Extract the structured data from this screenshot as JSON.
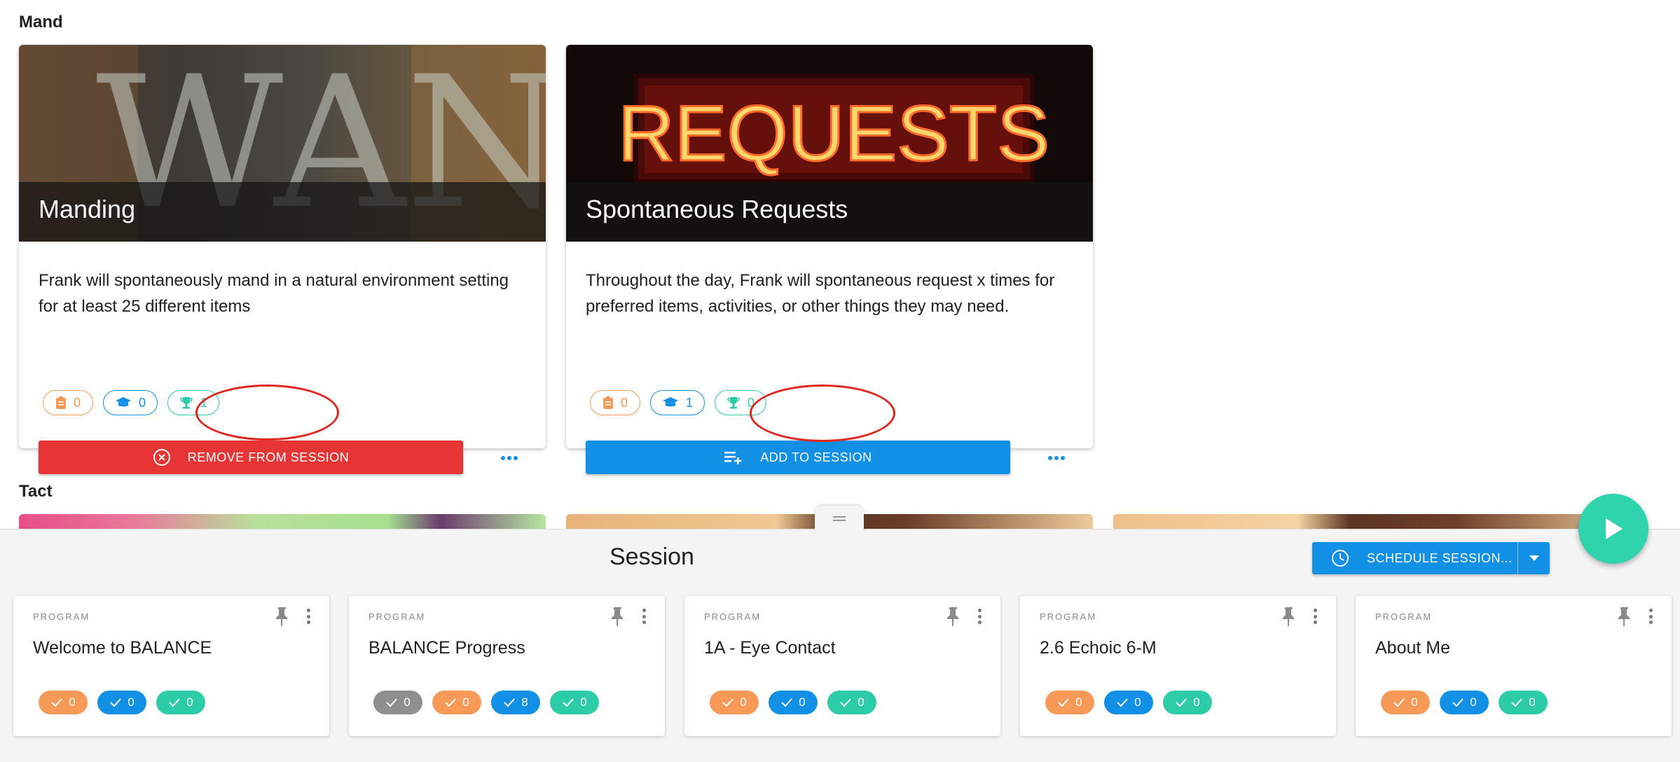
{
  "sections": {
    "mand_title": "Mand",
    "tact_title": "Tact"
  },
  "cards": [
    {
      "image_text": "WANT",
      "title": "Manding",
      "description": "Frank will spontaneously mand in a natural environment setting for at least 25 different items",
      "chips": {
        "clipboard": "0",
        "cap": "0",
        "trophy": "1"
      },
      "action_label": "REMOVE FROM SESSION",
      "action_color": "#e73535"
    },
    {
      "image_text": "REQUESTS",
      "title": "Spontaneous Requests",
      "description": "Throughout the day, Frank will spontaneous request x times for preferred items, activities, or other things they may need.",
      "chips": {
        "clipboard": "0",
        "cap": "1",
        "trophy": "0"
      },
      "action_label": "ADD TO SESSION",
      "action_color": "#1190e6"
    }
  ],
  "session": {
    "title": "Session",
    "schedule_label": "SCHEDULE SESSION...",
    "programs": [
      {
        "type": "PROGRAM",
        "name": "Welcome to BALANCE",
        "chips": [
          {
            "color": "orange",
            "value": "0"
          },
          {
            "color": "blue",
            "value": "0"
          },
          {
            "color": "green",
            "value": "0"
          }
        ]
      },
      {
        "type": "PROGRAM",
        "name": "BALANCE Progress",
        "chips": [
          {
            "color": "gray",
            "value": "0"
          },
          {
            "color": "orange",
            "value": "0"
          },
          {
            "color": "blue",
            "value": "8"
          },
          {
            "color": "green",
            "value": "0"
          }
        ]
      },
      {
        "type": "PROGRAM",
        "name": "1A - Eye Contact",
        "chips": [
          {
            "color": "orange",
            "value": "0"
          },
          {
            "color": "blue",
            "value": "0"
          },
          {
            "color": "green",
            "value": "0"
          }
        ]
      },
      {
        "type": "PROGRAM",
        "name": "2.6 Echoic 6-M",
        "chips": [
          {
            "color": "orange",
            "value": "0"
          },
          {
            "color": "blue",
            "value": "0"
          },
          {
            "color": "green",
            "value": "0"
          }
        ]
      },
      {
        "type": "PROGRAM",
        "name": "About Me",
        "chips": [
          {
            "color": "orange",
            "value": "0"
          },
          {
            "color": "blue",
            "value": "0"
          },
          {
            "color": "green",
            "value": "0"
          }
        ]
      }
    ]
  },
  "colors": {
    "primary": "#1190e6",
    "danger": "#e73535",
    "accent_orange": "#f79a57",
    "accent_green": "#2ccca8"
  }
}
